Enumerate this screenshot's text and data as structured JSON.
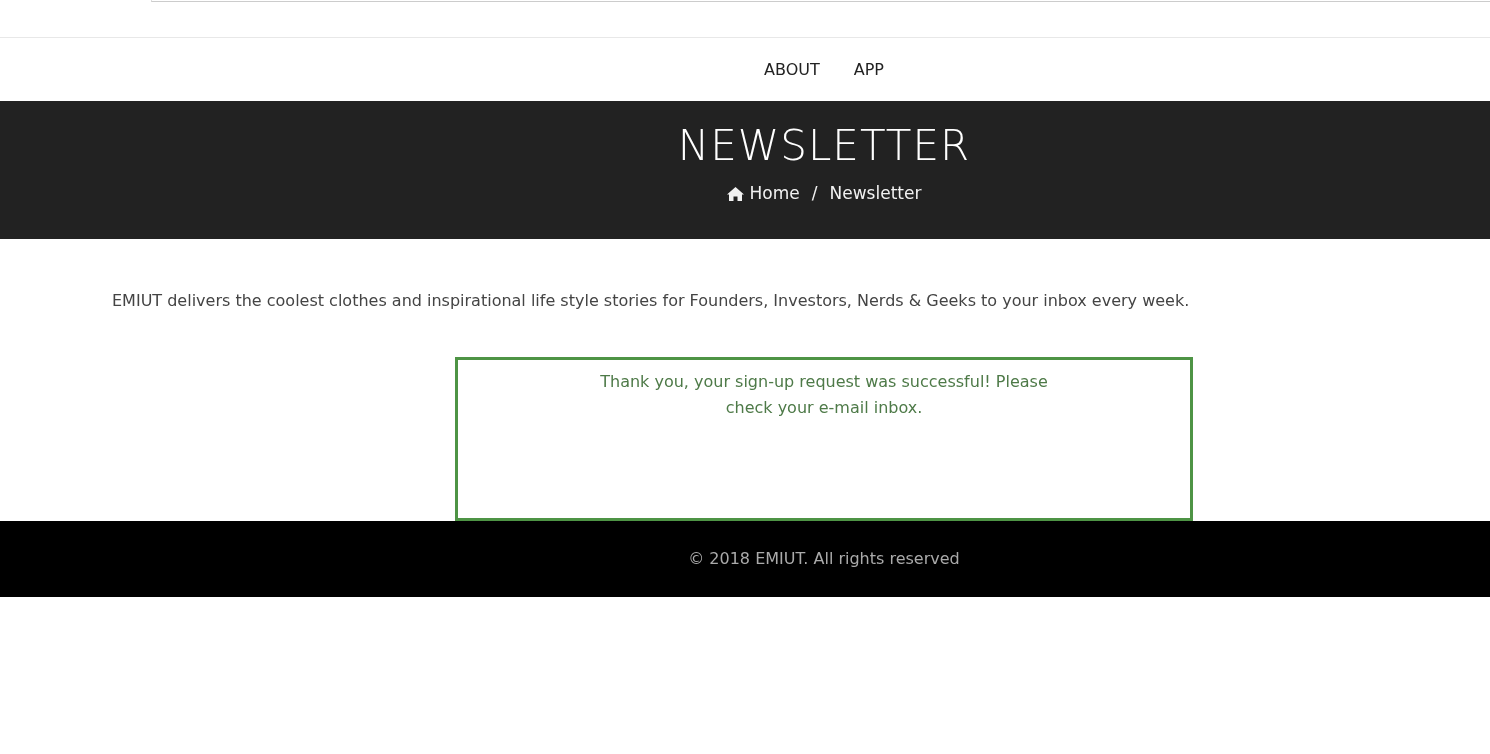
{
  "nav": {
    "items": [
      {
        "label": "ABOUT"
      },
      {
        "label": "APP"
      }
    ]
  },
  "banner": {
    "title": "NEWSLETTER",
    "breadcrumb": [
      {
        "label": "Home",
        "kind": "home"
      },
      {
        "label": "Newsletter",
        "kind": "current"
      }
    ],
    "separator": "/"
  },
  "intro": "EMIUT delivers the coolest clothes and inspirational life style stories for Founders, Investors, Nerds & Geeks to your inbox every week.",
  "alert": {
    "kind": "success",
    "message": "Thank you, your sign-up request was successful! Please check your e-mail inbox."
  },
  "footer": {
    "text": "© 2018 EMIUT. All rights reserved"
  }
}
